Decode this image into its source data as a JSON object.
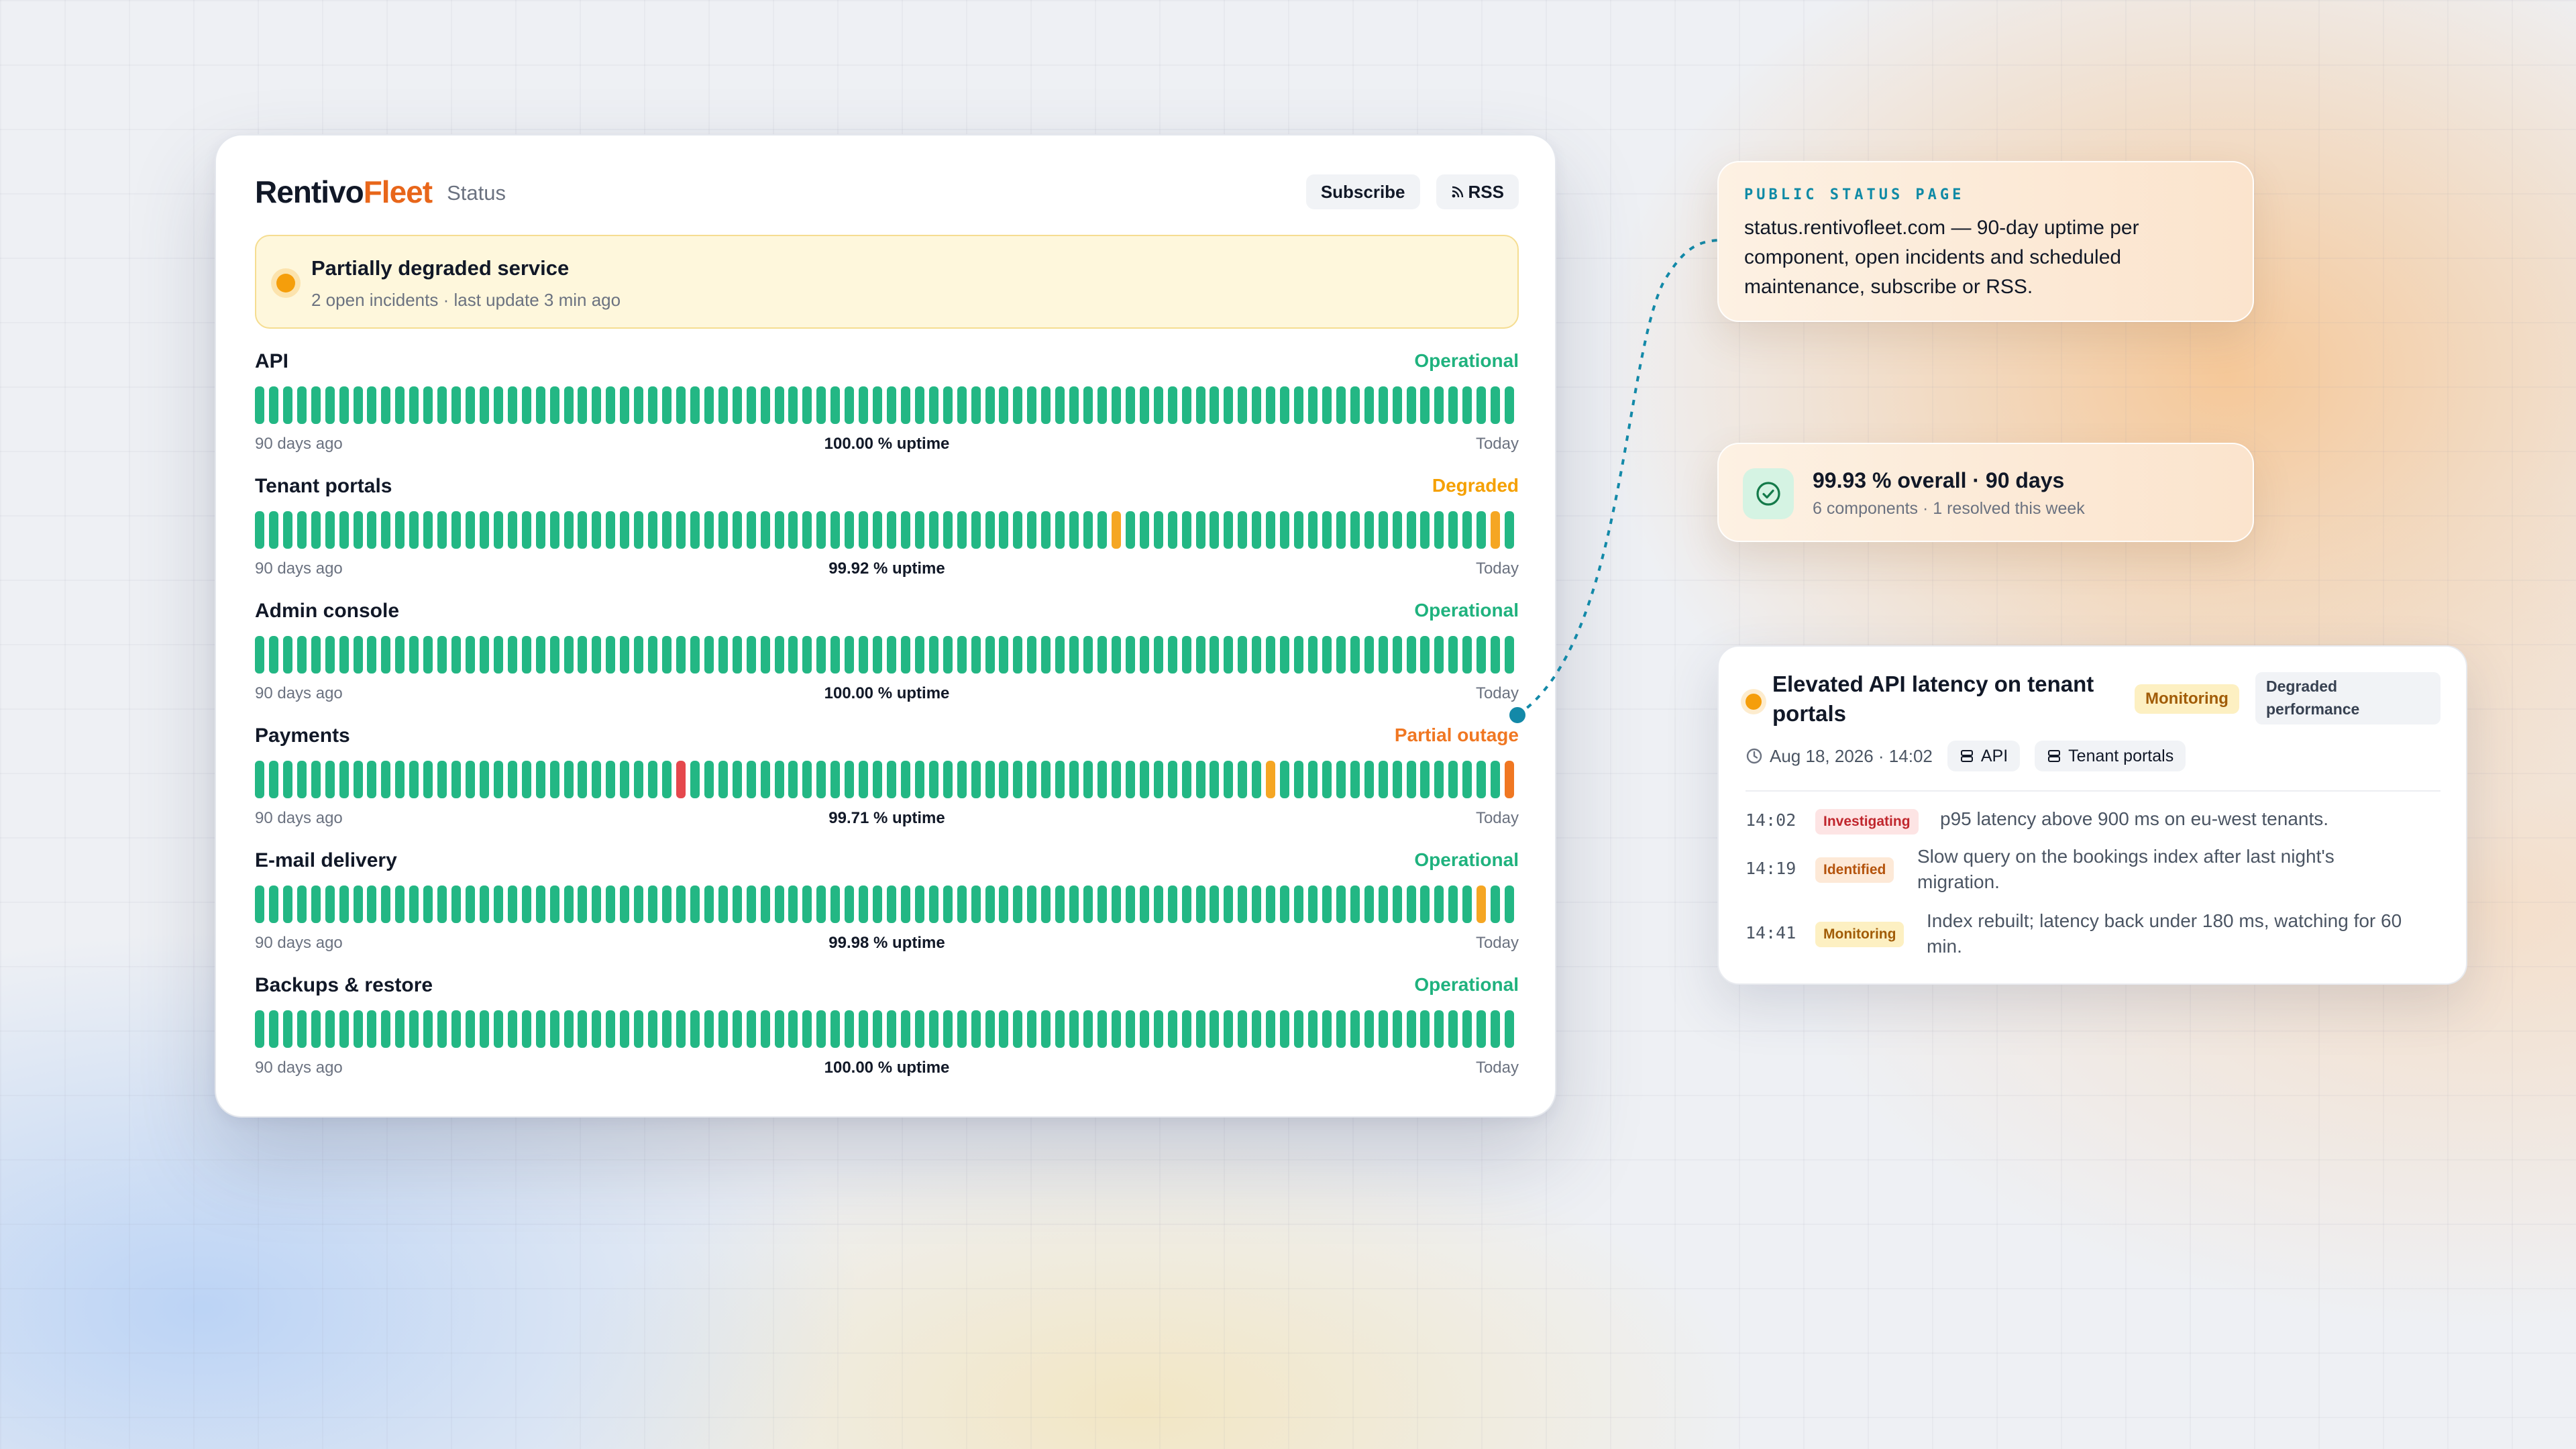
{
  "brand": {
    "name_part1": "Rentivo",
    "name_part2": "Fleet",
    "section": "Status"
  },
  "header": {
    "subscribe_label": "Subscribe",
    "rss_label": "RSS"
  },
  "banner": {
    "title": "Partially degraded service",
    "subtitle": "2 open incidents · last update 3 min ago"
  },
  "colors": {
    "operational": "#23b784",
    "degraded": "#f5a623",
    "partial_outage": "#f07722",
    "outage": "#e5484d",
    "brand_accent": "#e8661a"
  },
  "components": [
    {
      "name": "API",
      "status": "Operational",
      "status_color": "#1fb27e",
      "left_label": "90 days ago",
      "uptime": "100.00 % uptime",
      "right_label": "Today",
      "bars": {
        "count": 90,
        "incidents": []
      }
    },
    {
      "name": "Tenant portals",
      "status": "Degraded",
      "status_color": "#f5a000",
      "left_label": "90 days ago",
      "uptime": "99.92 % uptime",
      "right_label": "Today",
      "bars": {
        "count": 90,
        "incidents": [
          {
            "day": 61,
            "level": "degraded"
          },
          {
            "day": 88,
            "level": "degraded"
          }
        ]
      }
    },
    {
      "name": "Admin console",
      "status": "Operational",
      "status_color": "#1fb27e",
      "left_label": "90 days ago",
      "uptime": "100.00 % uptime",
      "right_label": "Today",
      "bars": {
        "count": 90,
        "incidents": []
      }
    },
    {
      "name": "Payments",
      "status": "Partial outage",
      "status_color": "#f07722",
      "left_label": "90 days ago",
      "uptime": "99.71 % uptime",
      "right_label": "Today",
      "bars": {
        "count": 90,
        "incidents": [
          {
            "day": 30,
            "level": "outage"
          },
          {
            "day": 72,
            "level": "degraded"
          },
          {
            "day": 89,
            "level": "partial_outage"
          }
        ]
      }
    },
    {
      "name": "E-mail delivery",
      "status": "Operational",
      "status_color": "#1fb27e",
      "left_label": "90 days ago",
      "uptime": "99.98 % uptime",
      "right_label": "Today",
      "bars": {
        "count": 90,
        "incidents": [
          {
            "day": 87,
            "level": "degraded"
          }
        ]
      }
    },
    {
      "name": "Backups & restore",
      "status": "Operational",
      "status_color": "#1fb27e",
      "left_label": "90 days ago",
      "uptime": "100.00 % uptime",
      "right_label": "Today",
      "bars": {
        "count": 90,
        "incidents": []
      }
    }
  ],
  "callout_info": {
    "kicker": "PUBLIC STATUS PAGE",
    "text": "status.rentivofleet.com — 90-day uptime per component, open incidents and scheduled maintenance, subscribe or RSS."
  },
  "callout_overall": {
    "title": "99.93 % overall · 90 days",
    "subtitle": "6 components · 1 resolved this week"
  },
  "incident": {
    "title": "Elevated API latency on tenant portals",
    "state_badge": "Monitoring",
    "impact_badge": "Degraded performance",
    "date": "Aug 18, 2026 · 14:02",
    "tags": [
      "API",
      "Tenant portals"
    ],
    "updates": [
      {
        "time": "14:02",
        "status": "Investigating",
        "text": "p95 latency above 900 ms on eu-west tenants."
      },
      {
        "time": "14:19",
        "status": "Identified",
        "text": "Slow query on the bookings index after last night's migration."
      },
      {
        "time": "14:41",
        "status": "Monitoring",
        "text": "Index rebuilt; latency back under 180 ms, watching for 60 min."
      }
    ]
  }
}
